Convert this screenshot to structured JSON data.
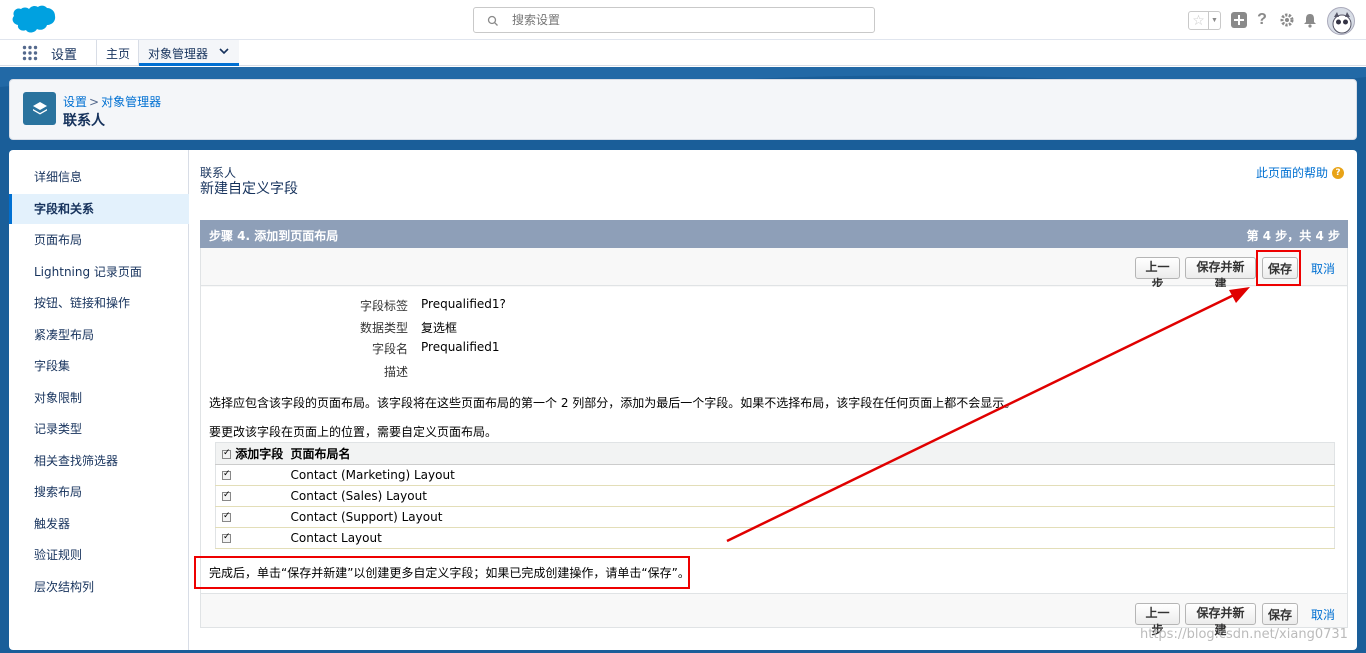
{
  "header": {
    "search_placeholder": "搜索设置"
  },
  "navbar": {
    "app_name": "设置",
    "home_tab": "主页",
    "object_manager_tab": "对象管理器"
  },
  "page_header": {
    "breadcrumb_setup": "设置",
    "breadcrumb_sep": ">",
    "breadcrumb_object_manager": "对象管理器",
    "title": "联系人"
  },
  "sidebar": {
    "items": [
      {
        "label": "详细信息",
        "active": false
      },
      {
        "label": "字段和关系",
        "active": true
      },
      {
        "label": "页面布局",
        "active": false
      },
      {
        "label": "Lightning 记录页面",
        "active": false
      },
      {
        "label": "按钮、链接和操作",
        "active": false
      },
      {
        "label": "紧凑型布局",
        "active": false
      },
      {
        "label": "字段集",
        "active": false
      },
      {
        "label": "对象限制",
        "active": false
      },
      {
        "label": "记录类型",
        "active": false
      },
      {
        "label": "相关查找筛选器",
        "active": false
      },
      {
        "label": "搜索布局",
        "active": false
      },
      {
        "label": "触发器",
        "active": false
      },
      {
        "label": "验证规则",
        "active": false
      },
      {
        "label": "层次结构列",
        "active": false
      }
    ]
  },
  "content": {
    "subtitle": "联系人",
    "title": "新建自定义字段",
    "help_link": "此页面的帮助",
    "step_title": "步骤 4. 添加到页面布局",
    "step_progress": "第 4 步，共 4 步",
    "buttons": {
      "previous": "上一步",
      "save_and_new": "保存并新建",
      "save": "保存",
      "cancel": "取消"
    },
    "fields": [
      {
        "label": "字段标签",
        "value": "Prequalified1?"
      },
      {
        "label": "数据类型",
        "value": "复选框"
      },
      {
        "label": "字段名",
        "value": "Prequalified1"
      },
      {
        "label": "描述",
        "value": ""
      }
    ],
    "instruction_1": "选择应包含该字段的页面布局。该字段将在这些页面布局的第一个 2 列部分，添加为最后一个字段。如果不选择布局，该字段在任何页面上都不会显示。",
    "instruction_2": "要更改该字段在页面上的位置，需要自定义页面布局。",
    "table": {
      "col_add": "添加字段",
      "col_layout": "页面布局名",
      "rows": [
        {
          "checked": true,
          "name": "Contact (Marketing) Layout"
        },
        {
          "checked": true,
          "name": "Contact (Sales) Layout"
        },
        {
          "checked": true,
          "name": "Contact (Support) Layout"
        },
        {
          "checked": true,
          "name": "Contact Layout"
        }
      ]
    },
    "note": "完成后，单击“保存并新建”以创建更多自定义字段；如果已完成创建操作，请单击“保存”。"
  },
  "watermark": "https://blog.csdn.net/xiang0731",
  "colors": {
    "brand_blue": "#1a5e99",
    "link_blue": "#0070d2",
    "step_bar": "#8e9fb8",
    "annotation_red": "#e00000"
  }
}
